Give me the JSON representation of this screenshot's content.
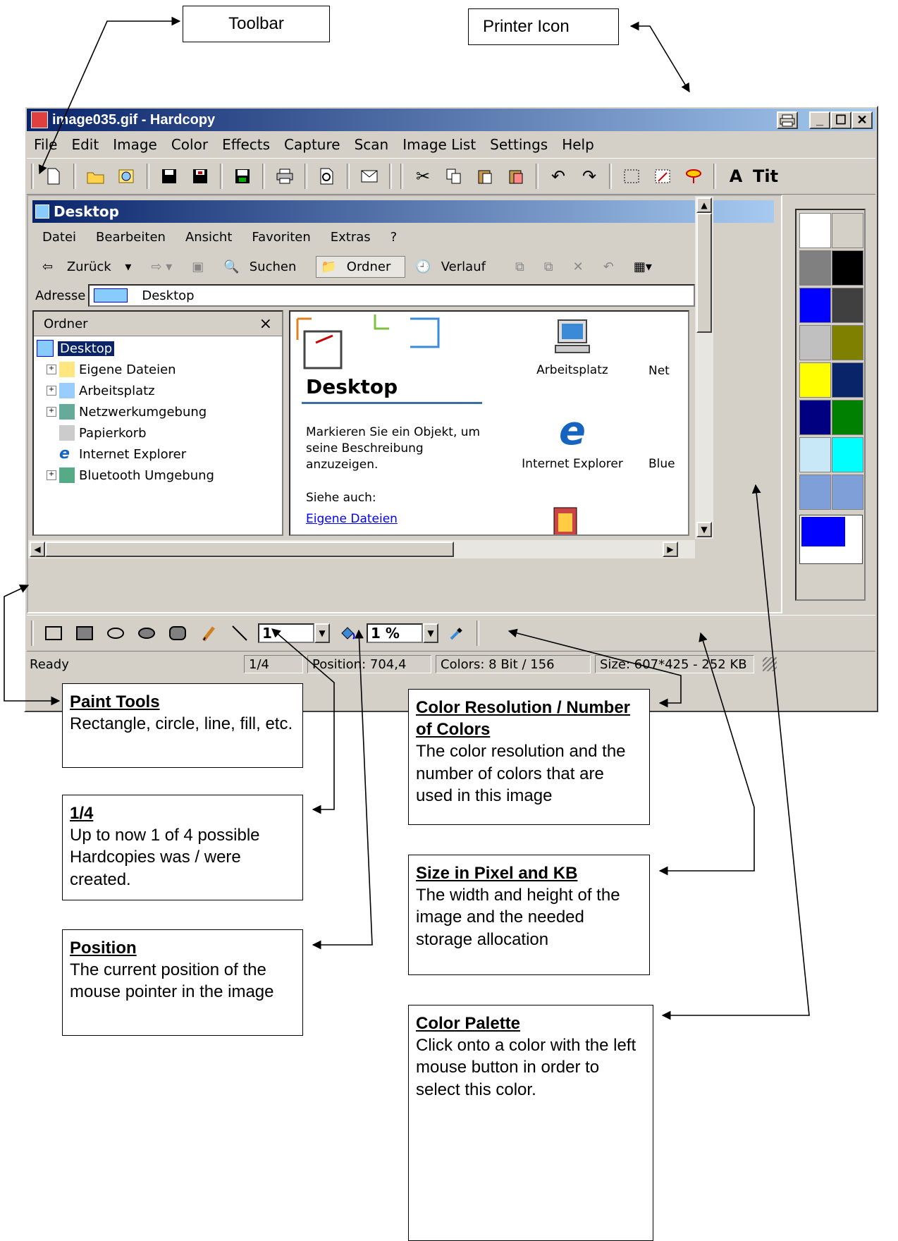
{
  "callouts": {
    "toolbar": "Toolbar",
    "printer_icon": "Printer Icon",
    "paint_tools": {
      "title": "Paint Tools",
      "text": "Rectangle, circle, line, fill, etc."
    },
    "hardcopies": {
      "title": "1/4",
      "text": "Up to now 1 of 4 possible Hardcopies was / were created."
    },
    "position": {
      "title": "Position",
      "text": "The current position of the mouse pointer in the image"
    },
    "color_resolution": {
      "title": "Color Resolution / Number of Colors",
      "text": "The color resolution and the number of colors that are used in this image"
    },
    "size": {
      "title": "Size in Pixel and KB",
      "text": "The width and height of the image and the needed storage allocation"
    },
    "color_palette": {
      "title": "Color Palette",
      "text": "Click onto a color with the left mouse button in order to select this color."
    }
  },
  "window": {
    "title": "image035.gif - Hardcopy",
    "menu": [
      "File",
      "Edit",
      "Image",
      "Color",
      "Effects",
      "Capture",
      "Scan",
      "Image List",
      "Settings",
      "Help"
    ],
    "toolbar_text_tools": [
      "A",
      "Tit"
    ]
  },
  "explorer": {
    "title": "Desktop",
    "menu": [
      "Datei",
      "Bearbeiten",
      "Ansicht",
      "Favoriten",
      "Extras",
      "?"
    ],
    "nav": {
      "back": "Zurück",
      "search": "Suchen",
      "folders": "Ordner",
      "history": "Verlauf"
    },
    "address_label": "Adresse",
    "address_value": "Desktop",
    "folder_pane_title": "Ordner",
    "folder_pane_close": "×",
    "tree": [
      "Desktop",
      "Eigene Dateien",
      "Arbeitsplatz",
      "Netzwerkumgebung",
      "Papierkorb",
      "Internet Explorer",
      "Bluetooth Umgebung"
    ],
    "heading": "Desktop",
    "description": "Markieren Sie ein Objekt, um seine Beschreibung anzuzeigen.",
    "see_also": "Siehe auch:",
    "link": "Eigene Dateien",
    "icons": [
      "Arbeitsplatz",
      "Internet Explorer"
    ],
    "icons_cut": [
      "Net",
      "Blue"
    ]
  },
  "paint": {
    "line_width": "1",
    "tolerance": "1 %"
  },
  "status": {
    "ready": "Ready",
    "count": "1/4",
    "position": "Position: 704,4",
    "colors": "Colors: 8 Bit / 156",
    "size": "Size: 607*425  -  252 KB"
  },
  "palette_colors": [
    "#ffffff",
    "#d4d0c8",
    "#808080",
    "#000000",
    "#0000ff",
    "#404040",
    "#c0c0c0",
    "#808000",
    "#ffff00",
    "#0a246a",
    "#000080",
    "#008000",
    "#c8e8f8",
    "#00ffff",
    "#7f9fd8",
    "#7f9fd8"
  ],
  "palette_selected": {
    "foreground": "#0000ff",
    "background": "#ffffff"
  }
}
